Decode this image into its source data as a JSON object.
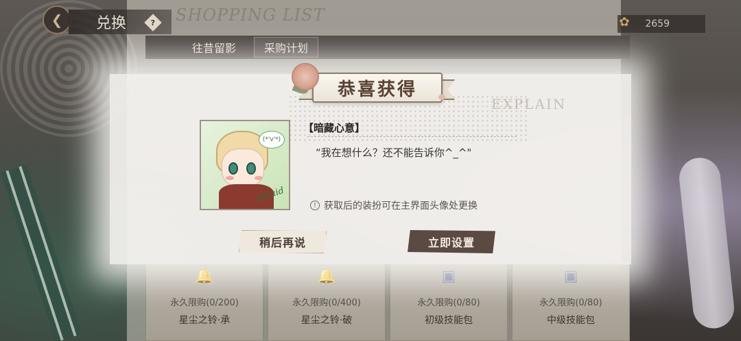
{
  "header": {
    "back_icon": "back-arrow-icon",
    "title": "兑换",
    "help": "?",
    "shopping_title": "SHOPPING LIST",
    "currency_icon": "rose-bouquet-icon",
    "currency_value": "2659"
  },
  "tabs": [
    {
      "label": "往昔留影"
    },
    {
      "label": "采购计划"
    }
  ],
  "background": {
    "explain_text": "EXPLAIN"
  },
  "shop_items": [
    {
      "limit": "永久限购(0/200)",
      "name": "星尘之铃·承",
      "icon": "bell-icon"
    },
    {
      "limit": "永久限购(0/400)",
      "name": "星尘之铃·破",
      "icon": "bell-icon"
    },
    {
      "limit": "永久限购(0/80)",
      "name": "初级技能包",
      "icon": "skill-pack-icon"
    },
    {
      "limit": "永久限购(0/80)",
      "name": "中级技能包",
      "icon": "skill-pack-icon"
    }
  ],
  "dialog": {
    "banner_title": "恭喜获得",
    "item_title": "【暗藏心意】",
    "quote": "“我在想什么？还不能告诉你^_^\"",
    "hint": "获取后的装扮可在主界面头像处更换",
    "hint_icon": "warning-icon",
    "avatar_bubble": "(*'v'*)",
    "avatar_signature": "Alkaid",
    "buttons": {
      "later": "稍后再说",
      "set_now": "立即设置"
    }
  },
  "colors": {
    "banner_text": "#5a4134",
    "primary_button": "#5a4a42",
    "secondary_button": "#efe8dc"
  }
}
